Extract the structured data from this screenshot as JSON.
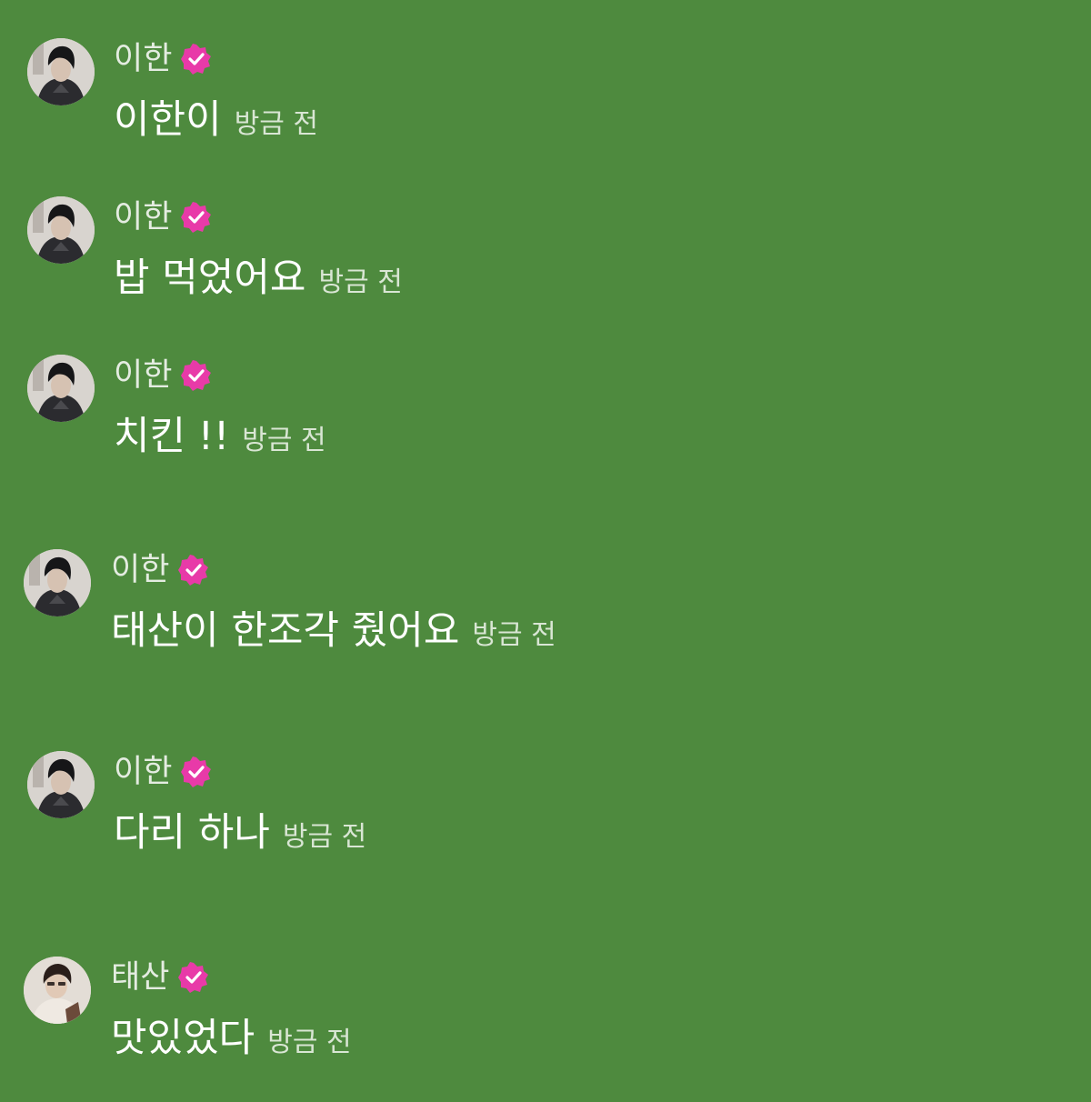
{
  "colors": {
    "background": "#4e8a3e",
    "badge": "#e83aa8",
    "text": "#ffffff",
    "meta": "#d9e6d4"
  },
  "messages": [
    {
      "author": "이한",
      "verified_icon": "verified-badge-icon",
      "text": "이한이",
      "time": "방금 전"
    },
    {
      "author": "이한",
      "verified_icon": "verified-badge-icon",
      "text": "밥 먹었어요",
      "time": "방금 전"
    },
    {
      "author": "이한",
      "verified_icon": "verified-badge-icon",
      "text": "치킨 !!",
      "time": "방금 전"
    },
    {
      "author": "이한",
      "verified_icon": "verified-badge-icon",
      "text": "태산이 한조각 줬어요",
      "time": "방금 전"
    },
    {
      "author": "이한",
      "verified_icon": "verified-badge-icon",
      "text": "다리 하나",
      "time": "방금 전"
    },
    {
      "author": "태산",
      "verified_icon": "verified-badge-icon",
      "text": "맛있었다",
      "time": "방금 전"
    }
  ]
}
